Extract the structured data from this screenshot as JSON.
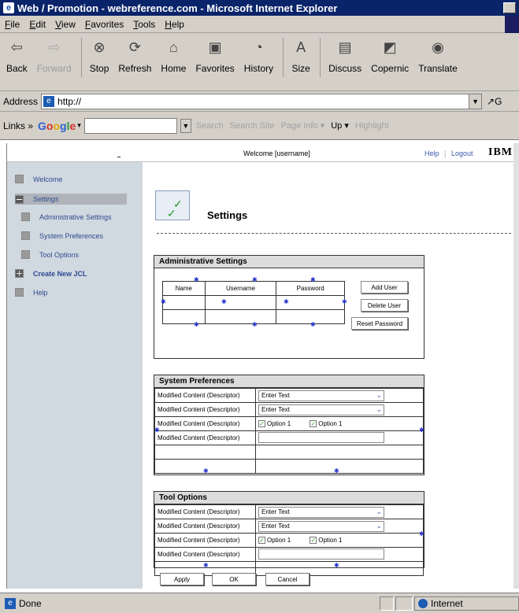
{
  "window": {
    "title": "Web / Promotion - webreference.com - Microsoft Internet Explorer"
  },
  "menu": [
    "File",
    "Edit",
    "View",
    "Favorites",
    "Tools",
    "Help"
  ],
  "toolbar": [
    {
      "label": "Back",
      "icon": "back-arrow-icon",
      "glyph": "⇦",
      "disabled": false
    },
    {
      "label": "Forward",
      "icon": "forward-arrow-icon",
      "glyph": "⇨",
      "disabled": true
    },
    {
      "label": "Stop",
      "icon": "stop-icon",
      "glyph": "⊗",
      "disabled": false
    },
    {
      "label": "Refresh",
      "icon": "refresh-icon",
      "glyph": "⟳",
      "disabled": false
    },
    {
      "label": "Home",
      "icon": "home-icon",
      "glyph": "⌂",
      "disabled": false
    },
    {
      "label": "Favorites",
      "icon": "favorites-icon",
      "glyph": "▣",
      "disabled": false
    },
    {
      "label": "History",
      "icon": "history-icon",
      "glyph": "◔",
      "disabled": false
    },
    {
      "label": "Size",
      "icon": "text-size-icon",
      "glyph": "A",
      "disabled": false
    },
    {
      "label": "Discuss",
      "icon": "discuss-icon",
      "glyph": "▤",
      "disabled": false
    },
    {
      "label": "Copernic",
      "icon": "copernic-icon",
      "glyph": "◩",
      "disabled": false
    },
    {
      "label": "Translate",
      "icon": "translate-icon",
      "glyph": "◉",
      "disabled": false
    }
  ],
  "address": {
    "label": "Address",
    "value": "http://",
    "go": "G"
  },
  "links": {
    "label": "Links »",
    "google": [
      "G",
      "o",
      "o",
      "g",
      "l",
      "e"
    ],
    "items": [
      "Search",
      "Search Site",
      "Page Info ▾",
      "Up ▾",
      "Highlight"
    ]
  },
  "app": {
    "welcome": "Welcome [username]",
    "help": "Help",
    "divider": "|",
    "logout": "Logout",
    "brand": "IBM"
  },
  "sidebar": [
    {
      "label": "Welcome",
      "kind": "plain"
    },
    {
      "label": "Settings",
      "kind": "active"
    },
    {
      "label": "Administrative Settings",
      "kind": "sub"
    },
    {
      "label": "System Preferences",
      "kind": "sub"
    },
    {
      "label": "Tool Options",
      "kind": "sub"
    },
    {
      "label": "Create New JCL",
      "kind": "bold"
    },
    {
      "label": "Help",
      "kind": "plain"
    }
  ],
  "page": {
    "title": "Settings"
  },
  "admin": {
    "title": "Administrative Settings",
    "columns": [
      "Name",
      "Username",
      "Password"
    ],
    "buttons": [
      "Add User",
      "Delete User",
      "Reset Password"
    ]
  },
  "sysprefs": {
    "title": "System Preferences",
    "rows": [
      {
        "label": "Modified Content (Descriptor)",
        "type": "select",
        "value": "Enter Text"
      },
      {
        "label": "Modified Content (Descriptor)",
        "type": "select",
        "value": "Enter Text"
      },
      {
        "label": "Modified Content (Descriptor)",
        "type": "checks",
        "options": [
          "Option 1",
          "Option 1"
        ]
      },
      {
        "label": "Modified Content (Descriptor)",
        "type": "input",
        "value": ""
      }
    ]
  },
  "tooloptions": {
    "title": "Tool Options",
    "rows": [
      {
        "label": "Modified Content (Descriptor)",
        "type": "select",
        "value": "Enter Text"
      },
      {
        "label": "Modified Content (Descriptor)",
        "type": "select",
        "value": "Enter Text"
      },
      {
        "label": "Modified Content (Descriptor)",
        "type": "checks",
        "options": [
          "Option 1",
          "Option 1"
        ]
      },
      {
        "label": "Modified Content (Descriptor)",
        "type": "input",
        "value": ""
      }
    ]
  },
  "actions": [
    "Apply",
    "OK",
    "Cancel"
  ],
  "status": {
    "text": "Done",
    "zone": "Internet"
  }
}
